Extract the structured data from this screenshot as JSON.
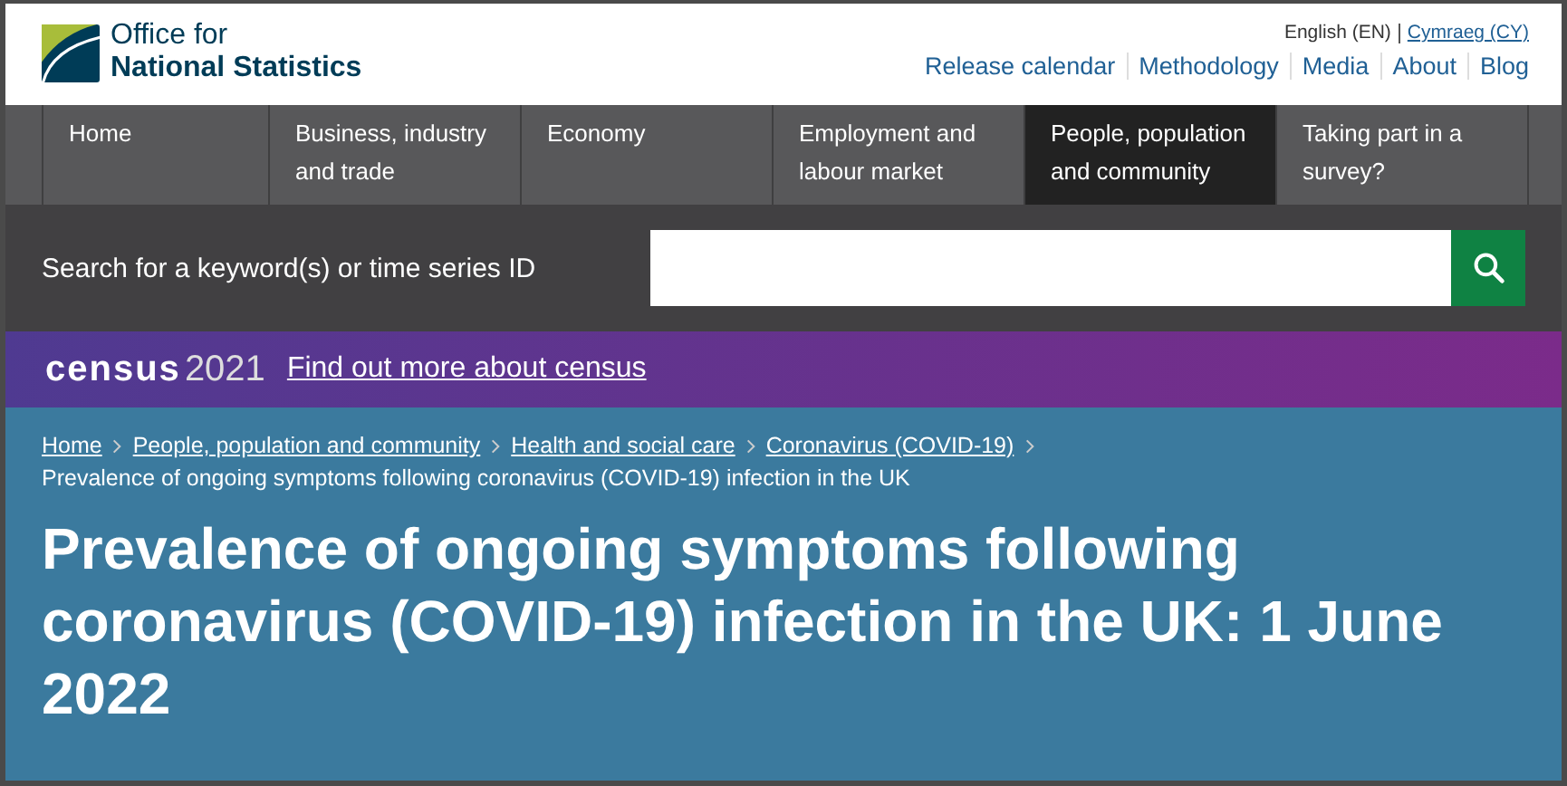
{
  "header": {
    "logo_text": [
      "Office for",
      "National Statistics"
    ],
    "languages": [
      {
        "label": "English (EN)",
        "selected": true
      },
      {
        "label": "Cymraeg (CY)",
        "selected": false
      }
    ],
    "links": [
      "Release calendar",
      "Methodology",
      "Media",
      "About",
      "Blog"
    ]
  },
  "nav": [
    {
      "label": "Home",
      "selected": false
    },
    {
      "label": "Business, industry and trade",
      "selected": false
    },
    {
      "label": "Economy",
      "selected": false
    },
    {
      "label": "Employment and labour market",
      "selected": false
    },
    {
      "label": "People, population and community",
      "selected": true
    },
    {
      "label": "Taking part in a survey?",
      "selected": false
    }
  ],
  "search": {
    "label": "Search for a keyword(s) or time series ID"
  },
  "census_banner": {
    "logo_word": "census",
    "logo_year": "2021",
    "link": "Find out more about census"
  },
  "breadcrumbs": [
    "Home",
    "People, population and community",
    "Health and social care",
    "Coronavirus (COVID-19)"
  ],
  "breadcrumb_current": "Prevalence of ongoing symptoms following coronavirus (COVID-19) infection in the UK",
  "title": "Prevalence of ongoing symptoms following coronavirus (COVID-19) infection in the UK: 1 June 2022"
}
